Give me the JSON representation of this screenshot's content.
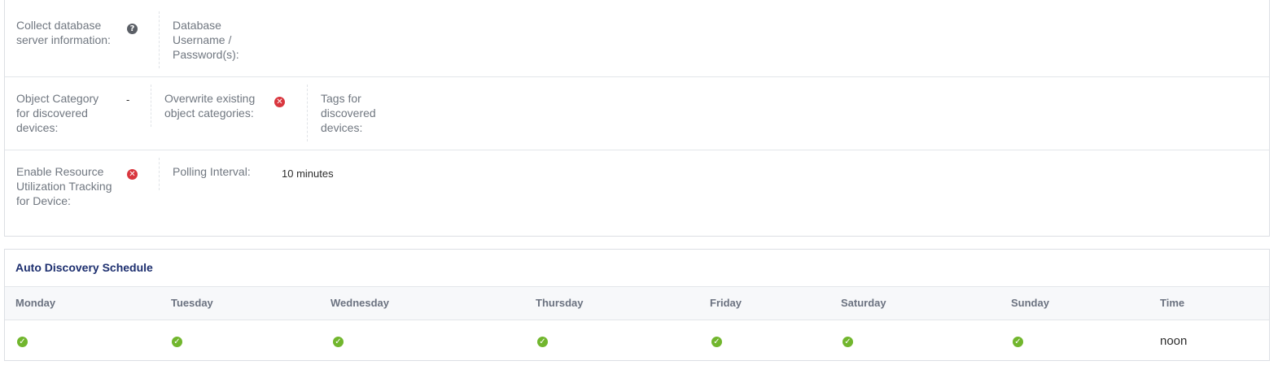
{
  "settings": {
    "collect_db_label": "Collect database server information:",
    "collect_db_icon": "question-circle-icon",
    "db_credentials_label": "Database Username / Password(s):",
    "object_category_label": "Object Category for discovered devices:",
    "object_category_value": "-",
    "overwrite_categories_label": "Overwrite existing object categories:",
    "overwrite_categories_icon": "x-circle-icon",
    "tags_label": "Tags for discovered devices:",
    "resource_tracking_label": "Enable Resource Utilization Tracking for Device:",
    "resource_tracking_icon": "x-circle-icon",
    "polling_interval_label": "Polling Interval:",
    "polling_interval_value": "10 minutes"
  },
  "schedule": {
    "title": "Auto Discovery Schedule",
    "columns": [
      "Monday",
      "Tuesday",
      "Wednesday",
      "Thursday",
      "Friday",
      "Saturday",
      "Sunday",
      "Time"
    ],
    "rows": [
      {
        "days": [
          "check-circle-icon",
          "check-circle-icon",
          "check-circle-icon",
          "check-circle-icon",
          "check-circle-icon",
          "check-circle-icon",
          "check-circle-icon"
        ],
        "time": "noon"
      }
    ]
  },
  "colors": {
    "check": "#71b62d",
    "cross": "#d9363e",
    "help": "#5b5f66",
    "title": "#1d2f6f"
  }
}
